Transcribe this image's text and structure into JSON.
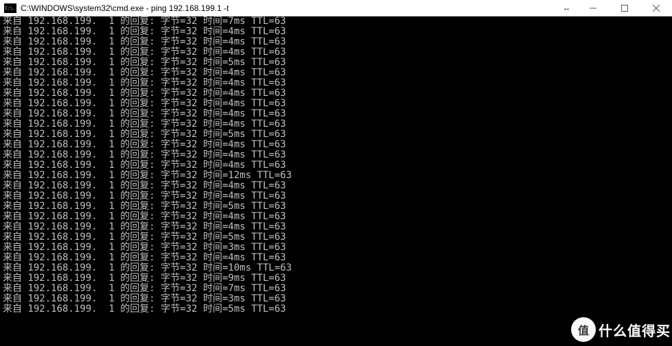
{
  "titlebar": {
    "icon_text": "C:\\.",
    "title": "C:\\WINDOWS\\system32\\cmd.exe - ping  192.168.199.1 -t",
    "resize_indicator": "↔"
  },
  "console": {
    "reply_prefix": "来自",
    "ip": "192.168.199.1",
    "reply_label": "的回复:",
    "bytes_label": "字节",
    "bytes_value": "32",
    "time_label": "时间",
    "ttl_label": "TTL",
    "ttl_value": "63",
    "lines": [
      {
        "time": "7ms"
      },
      {
        "time": "4ms"
      },
      {
        "time": "4ms"
      },
      {
        "time": "4ms"
      },
      {
        "time": "5ms"
      },
      {
        "time": "4ms"
      },
      {
        "time": "4ms"
      },
      {
        "time": "4ms"
      },
      {
        "time": "4ms"
      },
      {
        "time": "4ms"
      },
      {
        "time": "4ms"
      },
      {
        "time": "5ms"
      },
      {
        "time": "4ms"
      },
      {
        "time": "4ms"
      },
      {
        "time": "4ms"
      },
      {
        "time": "12ms"
      },
      {
        "time": "4ms"
      },
      {
        "time": "4ms"
      },
      {
        "time": "5ms"
      },
      {
        "time": "4ms"
      },
      {
        "time": "4ms"
      },
      {
        "time": "5ms"
      },
      {
        "time": "3ms"
      },
      {
        "time": "4ms"
      },
      {
        "time": "10ms"
      },
      {
        "time": "9ms"
      },
      {
        "time": "7ms"
      },
      {
        "time": "3ms"
      },
      {
        "time": "5ms"
      }
    ]
  },
  "watermark": {
    "badge": "值",
    "text": "什么值得买"
  }
}
